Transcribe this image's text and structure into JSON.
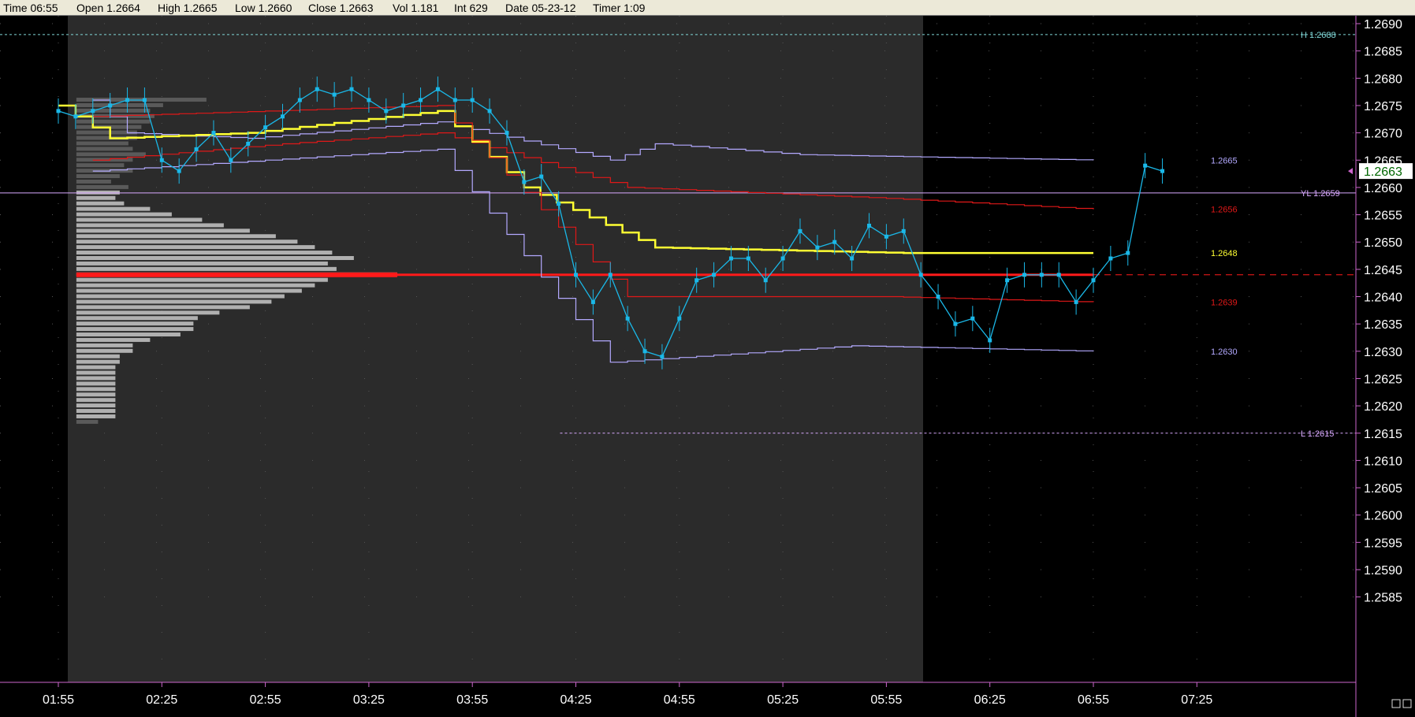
{
  "infobar": {
    "time": "Time 06:55",
    "open": "Open 1.2664",
    "high": "High 1.2665",
    "low": "Low 1.2660",
    "close": "Close 1.2663",
    "vol": "Vol 1.181",
    "int": "Int 629",
    "date": "Date 05-23-12",
    "timer": "Timer 1:09"
  },
  "chart_data": {
    "type": "line",
    "ylim": [
      1.2582,
      1.2692
    ],
    "y_ticks": [
      "1.2690",
      "1.2685",
      "1.2680",
      "1.2675",
      "1.2670",
      "1.2665",
      "1.2660",
      "1.2655",
      "1.2650",
      "1.2645",
      "1.2640",
      "1.2635",
      "1.2630",
      "1.2625",
      "1.2620",
      "1.2615",
      "1.2610",
      "1.2605",
      "1.2600",
      "1.2595",
      "1.2590",
      "1.2585"
    ],
    "x_ticks": [
      "01:55",
      "02:25",
      "02:55",
      "03:25",
      "03:55",
      "04:25",
      "04:55",
      "05:25",
      "05:55",
      "06:25",
      "06:55",
      "07:25"
    ],
    "last_price": "1.2663",
    "price_bars": {
      "time_start": "01:55",
      "minutes_per_bar": 5,
      "close": [
        1.2674,
        1.2673,
        1.2674,
        1.2675,
        1.2676,
        1.2676,
        1.2665,
        1.2663,
        1.2667,
        1.267,
        1.2665,
        1.2668,
        1.2671,
        1.2673,
        1.2676,
        1.2678,
        1.2677,
        1.2678,
        1.2676,
        1.2674,
        1.2675,
        1.2676,
        1.2678,
        1.2676,
        1.2676,
        1.2674,
        1.267,
        1.2661,
        1.2662,
        1.2657,
        1.2644,
        1.2639,
        1.2644,
        1.2636,
        1.263,
        1.2629,
        1.2636,
        1.2643,
        1.2644,
        1.2647,
        1.2647,
        1.2643,
        1.2647,
        1.2652,
        1.2649,
        1.265,
        1.2647,
        1.2653,
        1.2651,
        1.2652,
        1.2644,
        1.264,
        1.2635,
        1.2636,
        1.2632,
        1.2643,
        1.2644,
        1.2644,
        1.2644,
        1.2639,
        1.2643,
        1.2647,
        1.2648,
        1.2664,
        1.2663
      ]
    },
    "references": [
      {
        "label": "H 1.2688",
        "value": 1.2688,
        "color": "#7fd6d6"
      },
      {
        "label": "YL 1.2659",
        "value": 1.2659,
        "color": "#d9a9ff"
      },
      {
        "label": "L 1.2615",
        "value": 1.2615,
        "color": "#d9a9ff"
      }
    ],
    "series": [
      {
        "name": "",
        "label": "1.2665",
        "color": "#b3a9ff",
        "points": [
          [
            1.2676,
            "02:05"
          ],
          [
            1.267,
            "02:15"
          ],
          [
            1.2669,
            "02:50"
          ],
          [
            1.2672,
            "03:45"
          ],
          [
            1.2665,
            "04:35"
          ],
          [
            1.2668,
            "04:48"
          ],
          [
            1.2666,
            "05:30"
          ],
          [
            1.2665,
            "06:55"
          ]
        ]
      },
      {
        "name": "",
        "label": "1.2656",
        "color": "#e01818",
        "points": [
          [
            1.2665,
            "02:05"
          ],
          [
            1.2668,
            "03:00"
          ],
          [
            1.267,
            "03:45"
          ],
          [
            1.266,
            "04:40"
          ],
          [
            1.2658,
            "05:55"
          ],
          [
            1.2656,
            "06:55"
          ]
        ]
      },
      {
        "name": "",
        "label": "1.2648",
        "color": "#ffff33",
        "points": [
          [
            1.2675,
            "01:55"
          ],
          [
            1.2669,
            "02:10"
          ],
          [
            1.267,
            "02:50"
          ],
          [
            1.2674,
            "03:45"
          ],
          [
            1.266,
            "04:10"
          ],
          [
            1.2649,
            "04:48"
          ],
          [
            1.2648,
            "06:00"
          ],
          [
            1.2648,
            "06:55"
          ]
        ]
      },
      {
        "name": "",
        "label": "1.2639",
        "color": "#e01818",
        "points": [
          [
            1.2673,
            "02:05"
          ],
          [
            1.2675,
            "03:45"
          ],
          [
            1.264,
            "04:40"
          ],
          [
            1.264,
            "05:55"
          ],
          [
            1.2639,
            "06:55"
          ]
        ]
      },
      {
        "name": "",
        "label": "1.2630",
        "color": "#b3a9ff",
        "points": [
          [
            1.2663,
            "02:05"
          ],
          [
            1.2667,
            "03:45"
          ],
          [
            1.2628,
            "04:35"
          ],
          [
            1.2631,
            "05:45"
          ],
          [
            1.263,
            "06:55"
          ]
        ]
      }
    ],
    "poc": 1.2644,
    "volume_profile": [
      {
        "price": 1.2676,
        "count": 30
      },
      {
        "price": 1.2675,
        "count": 20
      },
      {
        "price": 1.2674,
        "count": 17
      },
      {
        "price": 1.2673,
        "count": 18
      },
      {
        "price": 1.2672,
        "count": 17
      },
      {
        "price": 1.2671,
        "count": 15
      },
      {
        "price": 1.267,
        "count": 14
      },
      {
        "price": 1.2669,
        "count": 14
      },
      {
        "price": 1.2668,
        "count": 12
      },
      {
        "price": 1.2667,
        "count": 13
      },
      {
        "price": 1.2666,
        "count": 16
      },
      {
        "price": 1.2665,
        "count": 13
      },
      {
        "price": 1.2664,
        "count": 11
      },
      {
        "price": 1.2663,
        "count": 13
      },
      {
        "price": 1.2662,
        "count": 10
      },
      {
        "price": 1.2661,
        "count": 8
      },
      {
        "price": 1.266,
        "count": 12
      },
      {
        "price": 1.2659,
        "count": 10
      },
      {
        "price": 1.2658,
        "count": 9
      },
      {
        "price": 1.2657,
        "count": 11
      },
      {
        "price": 1.2656,
        "count": 17
      },
      {
        "price": 1.2655,
        "count": 22
      },
      {
        "price": 1.2654,
        "count": 29
      },
      {
        "price": 1.2653,
        "count": 34
      },
      {
        "price": 1.2652,
        "count": 40
      },
      {
        "price": 1.2651,
        "count": 46
      },
      {
        "price": 1.265,
        "count": 51
      },
      {
        "price": 1.2649,
        "count": 55
      },
      {
        "price": 1.2648,
        "count": 59
      },
      {
        "price": 1.2647,
        "count": 64
      },
      {
        "price": 1.2646,
        "count": 58
      },
      {
        "price": 1.2645,
        "count": 60
      },
      {
        "price": 1.2644,
        "count": 74
      },
      {
        "price": 1.2643,
        "count": 58
      },
      {
        "price": 1.2642,
        "count": 55
      },
      {
        "price": 1.2641,
        "count": 52
      },
      {
        "price": 1.264,
        "count": 48
      },
      {
        "price": 1.2639,
        "count": 45
      },
      {
        "price": 1.2638,
        "count": 40
      },
      {
        "price": 1.2637,
        "count": 33
      },
      {
        "price": 1.2636,
        "count": 28
      },
      {
        "price": 1.2635,
        "count": 27
      },
      {
        "price": 1.2634,
        "count": 27
      },
      {
        "price": 1.2633,
        "count": 24
      },
      {
        "price": 1.2632,
        "count": 17
      },
      {
        "price": 1.2631,
        "count": 13
      },
      {
        "price": 1.263,
        "count": 13
      },
      {
        "price": 1.2629,
        "count": 10
      },
      {
        "price": 1.2628,
        "count": 10
      },
      {
        "price": 1.2627,
        "count": 9
      },
      {
        "price": 1.2626,
        "count": 9
      },
      {
        "price": 1.2625,
        "count": 9
      },
      {
        "price": 1.2624,
        "count": 9
      },
      {
        "price": 1.2623,
        "count": 9
      },
      {
        "price": 1.2622,
        "count": 9
      },
      {
        "price": 1.2621,
        "count": 9
      },
      {
        "price": 1.262,
        "count": 9
      },
      {
        "price": 1.2619,
        "count": 9
      },
      {
        "price": 1.2618,
        "count": 9
      },
      {
        "price": 1.2617,
        "count": 5
      }
    ]
  },
  "colors": {
    "background": "#000000",
    "session": "#2b2b2b",
    "axis": "#cc66cc",
    "price_line": "#1ab8e8",
    "yellow_line": "#ffff33",
    "red_line": "#e01818",
    "lavender_line": "#b3a9ff",
    "profile": "#b0b0b0",
    "profile_dark": "#5a5a5a",
    "poc": "#ff1a1a",
    "tick_text": "#ffffff",
    "last_price_box": "#ffffff",
    "last_price_text": "#006600"
  }
}
